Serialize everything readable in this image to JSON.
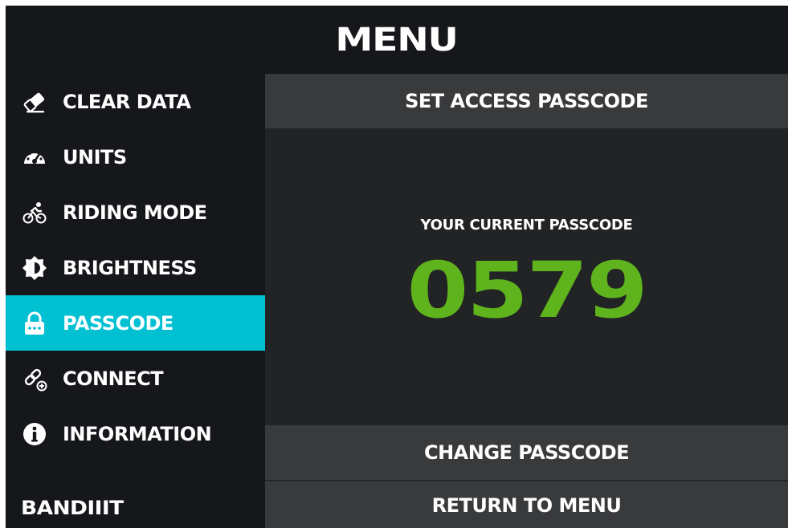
{
  "header": {
    "title": "MENU"
  },
  "sidebar": {
    "items": [
      {
        "label": "CLEAR DATA",
        "icon": "eraser-icon"
      },
      {
        "label": "UNITS",
        "icon": "speedometer-icon"
      },
      {
        "label": "RIDING MODE",
        "icon": "cyclist-icon"
      },
      {
        "label": "BRIGHTNESS",
        "icon": "brightness-icon"
      },
      {
        "label": "PASSCODE",
        "icon": "lock-icon",
        "active": true
      },
      {
        "label": "CONNECT",
        "icon": "link-plus-icon"
      },
      {
        "label": "INFORMATION",
        "icon": "info-icon"
      }
    ],
    "brand": "BANDIIIT"
  },
  "main": {
    "title": "SET ACCESS PASSCODE",
    "caption": "YOUR CURRENT PASSCODE",
    "passcode": "0579",
    "change_label": "CHANGE PASSCODE",
    "return_label": "RETURN TO MENU"
  },
  "colors": {
    "background": "#15171b",
    "accent": "#00c0d2",
    "passcode": "#5fb31d",
    "panel": "#222325",
    "button": "#393a3c"
  }
}
